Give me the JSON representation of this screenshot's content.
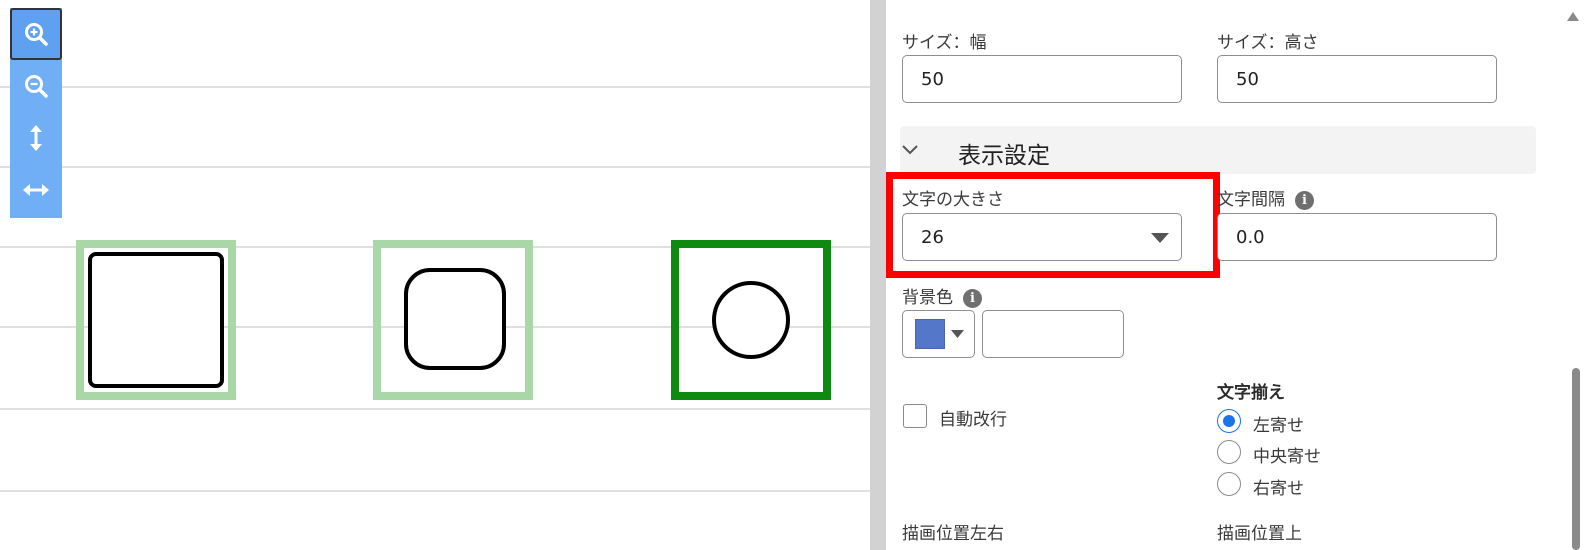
{
  "canvas": {
    "toolbar": [
      {
        "icon": "zoom-in-icon",
        "active": true
      },
      {
        "icon": "zoom-out-icon",
        "active": false
      },
      {
        "icon": "fit-height-icon",
        "active": false
      },
      {
        "icon": "fit-width-icon",
        "active": false
      }
    ],
    "shapes": [
      {
        "type": "rectangle",
        "selected": false
      },
      {
        "type": "rounded-rectangle",
        "selected": false
      },
      {
        "type": "circle",
        "selected": true
      }
    ]
  },
  "panel": {
    "size_width_label": "サイズ：幅",
    "size_width_value": "50",
    "size_height_label": "サイズ：高さ",
    "size_height_value": "50",
    "section_title": "表示設定",
    "font_size_label": "文字の大きさ",
    "font_size_value": "26",
    "letter_spacing_label": "文字間隔",
    "letter_spacing_value": "0.0",
    "background_color_label": "背景色",
    "background_color_swatch": "#5577c9",
    "background_color_value": "",
    "auto_wrap_label": "自動改行",
    "auto_wrap_checked": false,
    "text_align_label": "文字揃え",
    "text_align_options": [
      {
        "label": "左寄せ",
        "checked": true
      },
      {
        "label": "中央寄せ",
        "checked": false
      },
      {
        "label": "右寄せ",
        "checked": false
      }
    ],
    "draw_pos_x_label": "描画位置左右",
    "draw_pos_y_label": "描画位置上"
  },
  "colors": {
    "highlight": "#ff0000",
    "toolbar": "#70aef6",
    "selection_light": "#a9d7a8",
    "selection_dark": "#0e8a10",
    "radio_accent": "#1a73e8"
  }
}
